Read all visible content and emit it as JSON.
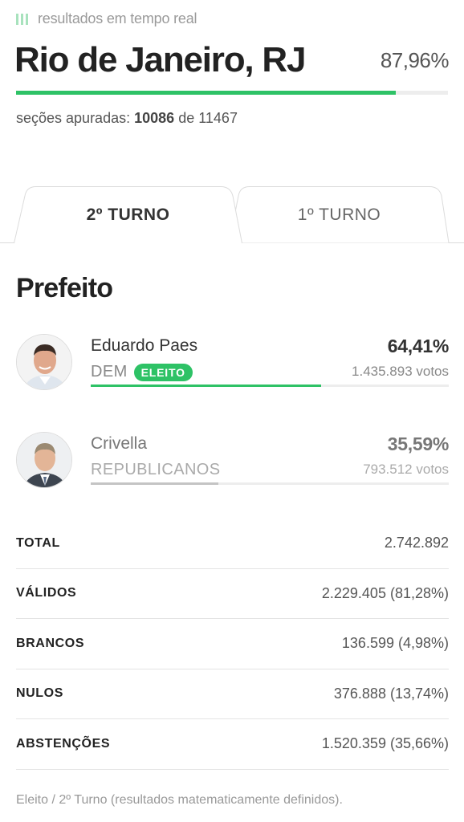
{
  "header": {
    "live_label": "resultados em tempo real",
    "city": "Rio de Janeiro, RJ",
    "percent_counted": "87,96%",
    "progress_fraction": 0.8796,
    "sections_prefix": "seções apuradas:",
    "sections_counted": "10086",
    "sections_of": "de",
    "sections_total": "11467"
  },
  "tabs": [
    {
      "label": "2º TURNO",
      "active": true
    },
    {
      "label": "1º TURNO",
      "active": false
    }
  ],
  "office": "Prefeito",
  "candidates": [
    {
      "name": "Eduardo Paes",
      "party": "DEM",
      "badge": "ELEITO",
      "percent": "64,41%",
      "votes": "1.435.893 votos",
      "share": 0.6441,
      "bar_color": "#2ec266"
    },
    {
      "name": "Crivella",
      "party": "REPUBLICANOS",
      "percent": "35,59%",
      "votes": "793.512 votos",
      "share": 0.3559,
      "bar_color": "#c4c4c4"
    }
  ],
  "totals": [
    {
      "label": "TOTAL",
      "value": "2.742.892"
    },
    {
      "label": "VÁLIDOS",
      "value": "2.229.405 (81,28%)"
    },
    {
      "label": "BRANCOS",
      "value": "136.599 (4,98%)"
    },
    {
      "label": "NULOS",
      "value": "376.888 (13,74%)"
    },
    {
      "label": "ABSTENÇÕES",
      "value": "1.520.359 (35,66%)"
    }
  ],
  "footnote": "Eleito / 2º Turno (resultados matematicamente definidos).",
  "colors": {
    "accent": "#2ec266",
    "live_indicator": "#a8e2bd"
  }
}
